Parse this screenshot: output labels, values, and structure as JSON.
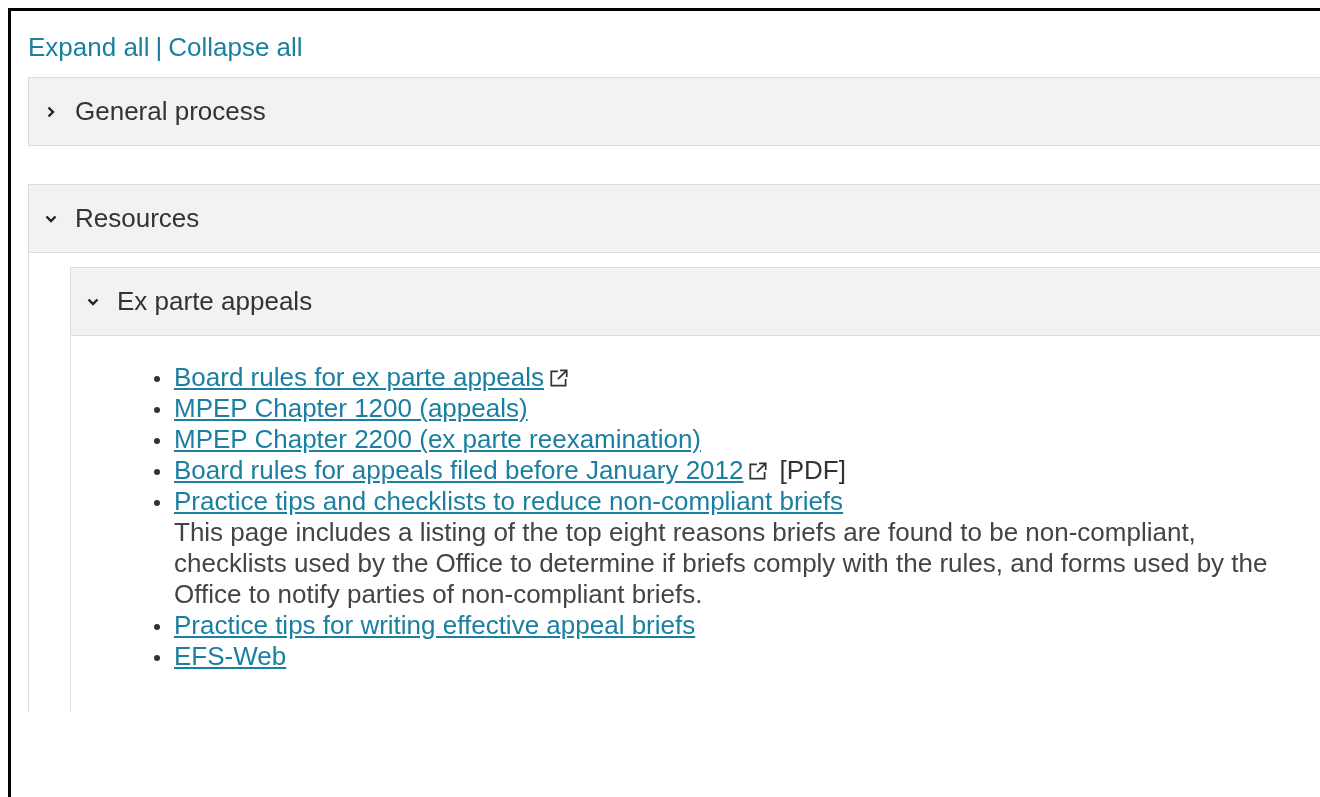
{
  "toolbar": {
    "expand_all": "Expand all",
    "separator": "|",
    "collapse_all": "Collapse all"
  },
  "sections": [
    {
      "title": "General process",
      "expanded": false
    },
    {
      "title": "Resources",
      "expanded": true,
      "children": [
        {
          "title": "Ex parte appeals",
          "expanded": true,
          "links": [
            {
              "label": "Board rules for ex parte appeals",
              "external": true
            },
            {
              "label": "MPEP Chapter 1200 (appeals)",
              "external": false
            },
            {
              "label": "MPEP Chapter 2200 (ex parte reexamination)",
              "external": false
            },
            {
              "label": "Board rules for appeals filed before January 2012",
              "external": true,
              "suffix": "[PDF]"
            },
            {
              "label": "Practice tips and checklists to reduce non-compliant briefs",
              "external": false,
              "description": "This page includes a listing of the top eight reasons briefs are found to be non-compliant, checklists used by the Office to determine if briefs comply with the rules, and forms used by the Office to notify parties of non-compliant briefs."
            },
            {
              "label": "Practice tips for writing effective appeal briefs",
              "external": false
            },
            {
              "label": "EFS-Web",
              "external": false
            }
          ]
        }
      ]
    }
  ]
}
